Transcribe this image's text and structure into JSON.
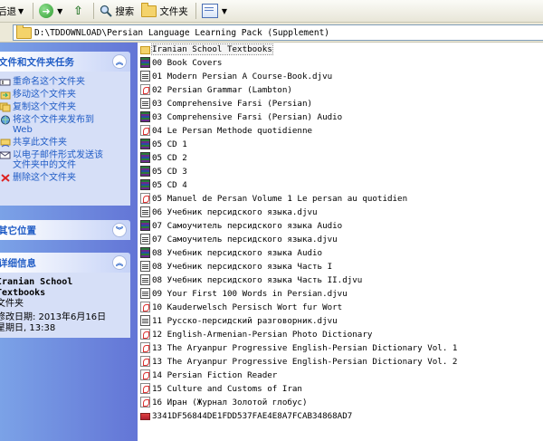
{
  "toolbar": {
    "back_label": "后退",
    "search_label": "搜索",
    "folders_label": "文件夹"
  },
  "address": {
    "path": "D:\\TDDOWNLOAD\\Persian Language Learning Pack (Supplement)"
  },
  "tasks_panel": {
    "title": "文件和文件夹任务",
    "items": [
      {
        "label": "重命名这个文件夹"
      },
      {
        "label": "移动这个文件夹"
      },
      {
        "label": "复制这个文件夹"
      },
      {
        "label": "将这个文件夹发布到",
        "label2": "Web"
      },
      {
        "label": "共享此文件夹"
      },
      {
        "label": "以电子邮件形式发送该",
        "label2": "文件夹中的文件"
      },
      {
        "label": "删除这个文件夹"
      }
    ]
  },
  "other_places": {
    "title": "其它位置"
  },
  "details_panel": {
    "title": "详细信息",
    "name_line1": "Iranian School",
    "name_line2": "Textbooks",
    "type": "文件夹",
    "modified_label": "修改日期: 2013年6月16日",
    "modified_time": "星期日, 13:38"
  },
  "files": [
    {
      "name": "Iranian School Textbooks",
      "icon": "folder-icon"
    },
    {
      "name": "00 Book Covers",
      "icon": "media-icon"
    },
    {
      "name": "01 Modern Persian A Course-Book.djvu",
      "icon": "djvu-icon"
    },
    {
      "name": "02 Persian Grammar (Lambton)",
      "icon": "pdf-icon"
    },
    {
      "name": "03 Comprehensive Farsi (Persian)",
      "icon": "djvu-icon"
    },
    {
      "name": "03 Comprehensive Farsi (Persian) Audio",
      "icon": "media-icon"
    },
    {
      "name": "04 Le Persan Methode quotidienne",
      "icon": "pdf-icon"
    },
    {
      "name": "05 CD 1",
      "icon": "media-icon"
    },
    {
      "name": "05 CD 2",
      "icon": "media-icon"
    },
    {
      "name": "05 CD 3",
      "icon": "media-icon"
    },
    {
      "name": "05 CD 4",
      "icon": "media-icon"
    },
    {
      "name": "05 Manuel de Persan Volume 1 Le persan au quotidien",
      "icon": "pdf-icon"
    },
    {
      "name": "06 Учебник персидского языка.djvu",
      "icon": "djvu-icon"
    },
    {
      "name": "07 Самоучитель персидского языка Audio",
      "icon": "media-icon"
    },
    {
      "name": "07 Самоучитель персидского языка.djvu",
      "icon": "djvu-icon"
    },
    {
      "name": "08 Учебник персидского языка Audio",
      "icon": "media-icon"
    },
    {
      "name": "08 Учебник персидского языка Часть I",
      "icon": "djvu-icon"
    },
    {
      "name": "08 Учебник персидского языка Часть II.djvu",
      "icon": "djvu-icon"
    },
    {
      "name": "09 Your First 100 Words in Persian.djvu",
      "icon": "djvu-icon"
    },
    {
      "name": "10 Kauderwelsch Persisch Wort fur Wort",
      "icon": "pdf-icon"
    },
    {
      "name": "11 Русско-персидский разговорник.djvu",
      "icon": "djvu-icon"
    },
    {
      "name": "12 English-Armenian-Persian Photo Dictionary",
      "icon": "pdf-icon"
    },
    {
      "name": "13 The Aryanpur Progressive English-Persian Dictionary Vol. 1",
      "icon": "pdf-icon"
    },
    {
      "name": "13 The Aryanpur Progressive English-Persian Dictionary Vol. 2",
      "icon": "pdf-icon"
    },
    {
      "name": "14 Persian Fiction Reader",
      "icon": "pdf-icon"
    },
    {
      "name": "15 Culture and Customs of Iran",
      "icon": "pdf-icon"
    },
    {
      "name": "16 Иран (Журнал Золотой глобус)",
      "icon": "pdf-icon"
    },
    {
      "name": "3341DF56844DE1FDD537FAE4E8A7FCAB34868AD7",
      "icon": "rar-icon"
    }
  ]
}
